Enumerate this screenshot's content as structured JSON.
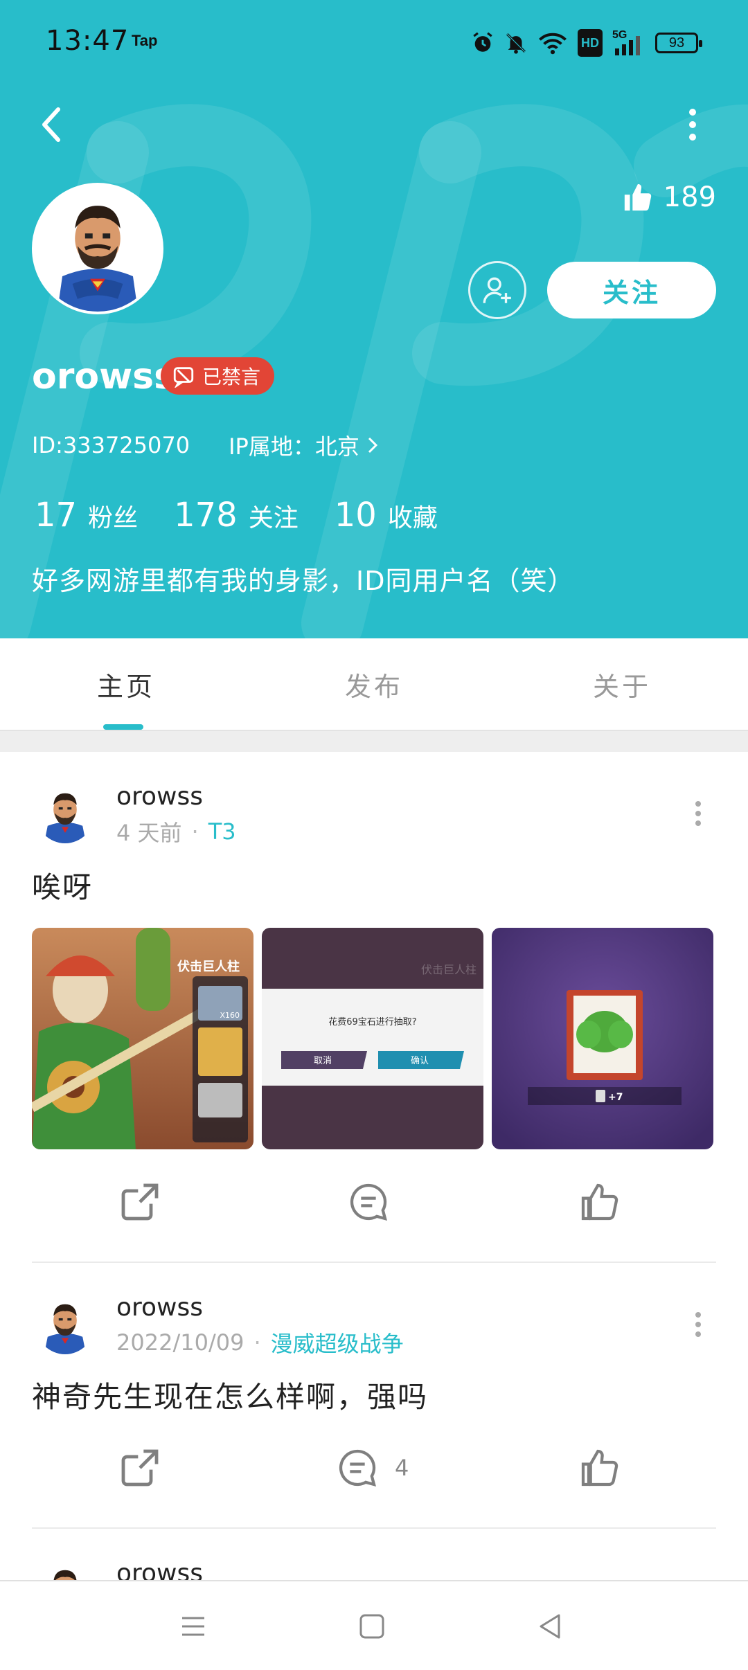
{
  "status_bar": {
    "time": "13:47",
    "app_tag": "Tap",
    "hd_label": "HD",
    "network": "5G",
    "battery": "93"
  },
  "profile": {
    "likes": "189",
    "follow_label": "关注",
    "username": "orowss",
    "mute_badge": "已禁言",
    "id_text": "ID:333725070",
    "ip_text": "IP属地：北京",
    "stats": [
      {
        "num": "17",
        "label": "粉丝"
      },
      {
        "num": "178",
        "label": "关注"
      },
      {
        "num": "10",
        "label": "收藏"
      }
    ],
    "bio": "好多网游里都有我的身影，ID同用户名（笑）"
  },
  "tabs": [
    {
      "label": "主页",
      "active": true
    },
    {
      "label": "发布",
      "active": false
    },
    {
      "label": "关于",
      "active": false
    }
  ],
  "posts": [
    {
      "user": "orowss",
      "time": "4 天前",
      "tag": "T3",
      "text": "唉呀",
      "images": [
        {
          "caption": "伏击巨人柱",
          "count": "X160"
        },
        {
          "caption": "花费69宝石进行抽取?",
          "cancel": "取消",
          "confirm": "确认",
          "watermark": "伏击巨人柱"
        },
        {
          "caption": "+7"
        }
      ],
      "comments": ""
    },
    {
      "user": "orowss",
      "time": "2022/10/09",
      "tag": "漫威超级战争",
      "text": "神奇先生现在怎么样啊，强吗",
      "comments": "4"
    },
    {
      "user": "orowss"
    }
  ],
  "colors": {
    "brand": "#28bdca",
    "mute_red": "#e24536"
  },
  "icons": [
    "back-icon",
    "more-vertical-icon",
    "thumbs-up-icon",
    "add-friend-icon",
    "share-icon",
    "comment-icon",
    "like-icon",
    "menu-icon",
    "home-square-icon",
    "back-triangle-icon"
  ]
}
